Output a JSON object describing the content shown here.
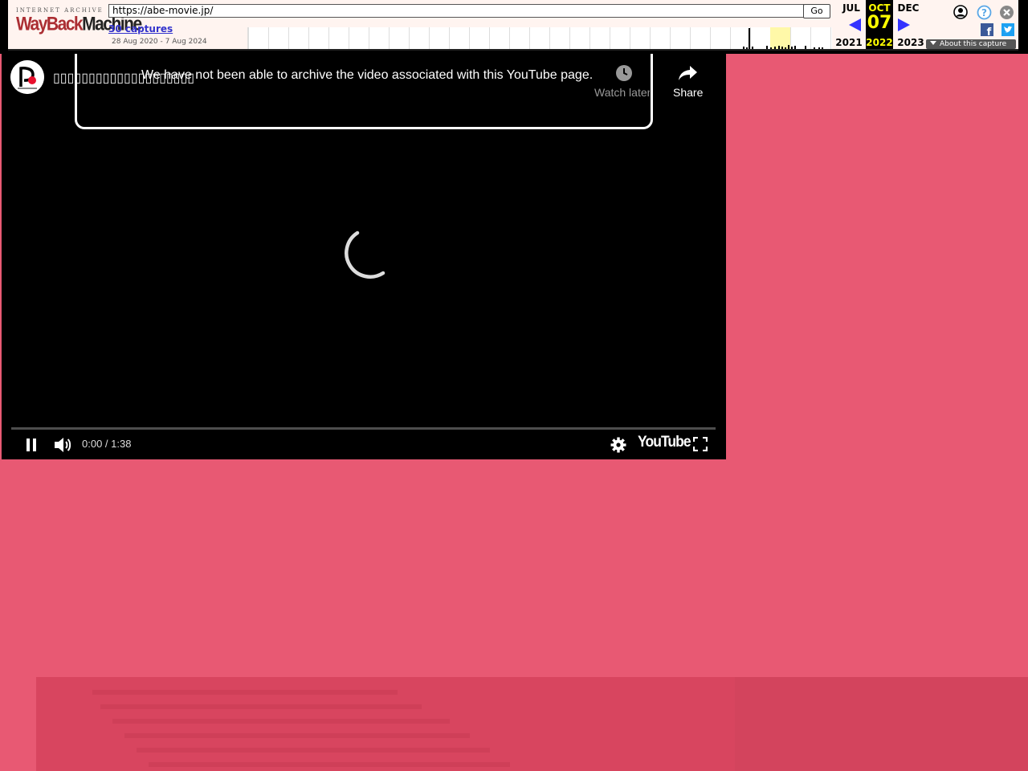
{
  "wayback": {
    "logo_top": "INTERNET ARCHIVE",
    "logo_way": "WayBack",
    "logo_machine": "Machine",
    "url_value": "https://abe-movie.jp/",
    "go_label": "Go",
    "captures_label": "30 captures",
    "date_range": "28 Aug 2020 - 7 Aug 2024",
    "prev_month": "JUL",
    "cur_month": "OCT",
    "next_month": "DEC",
    "cur_day": "07",
    "prev_year": "2021",
    "cur_year": "2022",
    "next_year": "2023",
    "about_label": "About this capture",
    "icons": [
      "account-icon",
      "help-icon",
      "close-icon",
      "facebook-icon",
      "twitter-icon"
    ]
  },
  "player": {
    "notice": "We have not been able to archive the video associated with this YouTube page.",
    "title": "▯▯▯▯▯▯▯▯▯▯▯▯▯▯▯▯▯▯▯▯",
    "watch_later_label": "Watch later",
    "share_label": "Share",
    "time": "0:00 / 1:38",
    "brand": "YouTube",
    "progress": 0
  },
  "colors": {
    "page_bg": "#e85973",
    "player_bg": "#000000",
    "wayback_bg": "#fff4f0",
    "wayback_highlight": "#ffff00",
    "wayback_link": "#3333cc"
  }
}
